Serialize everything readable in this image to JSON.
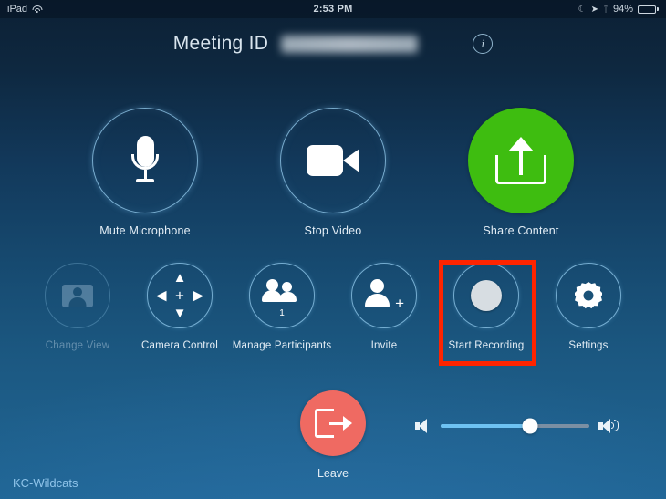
{
  "statusbar": {
    "device": "iPad",
    "wifi_icon": "wifi-icon",
    "time": "2:53 PM",
    "moon_icon": "do-not-disturb-moon-icon",
    "location_icon": "location-arrow-icon",
    "bluetooth_icon": "bluetooth-icon",
    "battery_percent": "94%",
    "battery_level": 94
  },
  "header": {
    "meeting_id_label": "Meeting ID",
    "meeting_id_value": "",
    "meeting_id_redacted": true,
    "info_icon": "info-icon"
  },
  "controls": {
    "row1": [
      {
        "id": "mute-microphone",
        "label": "Mute Microphone",
        "icon": "microphone-icon",
        "style": "outline",
        "enabled": true
      },
      {
        "id": "stop-video",
        "label": "Stop Video",
        "icon": "video-camera-icon",
        "style": "outline",
        "enabled": true
      },
      {
        "id": "share-content",
        "label": "Share Content",
        "icon": "share-upload-icon",
        "style": "green-filled",
        "enabled": true,
        "color": "#3ebd10"
      }
    ],
    "row2": [
      {
        "id": "change-view",
        "label": "Change View",
        "icon": "contact-card-icon",
        "enabled": false
      },
      {
        "id": "camera-control",
        "label": "Camera Control",
        "icon": "camera-dpad-icon",
        "enabled": true
      },
      {
        "id": "manage-participants",
        "label": "Manage Participants",
        "icon": "two-people-icon",
        "enabled": true,
        "badge": "1"
      },
      {
        "id": "invite",
        "label": "Invite",
        "icon": "add-person-icon",
        "enabled": true
      },
      {
        "id": "start-recording",
        "label": "Start Recording",
        "icon": "record-dot-icon",
        "enabled": true,
        "highlighted": true
      },
      {
        "id": "settings",
        "label": "Settings",
        "icon": "gear-icon",
        "enabled": true
      }
    ]
  },
  "highlight": {
    "color": "#ff2400",
    "target": "start-recording"
  },
  "leave": {
    "label": "Leave",
    "icon": "exit-arrow-icon",
    "color": "#ef6a62"
  },
  "volume": {
    "low_icon": "speaker-low-icon",
    "high_icon": "speaker-high-icon",
    "value_percent": 60
  },
  "footer": {
    "network_name": "KC-Wildcats"
  },
  "theme": {
    "background_top": "#0c2034",
    "background_bottom": "#1f6594",
    "ring_color": "#96cdf0",
    "text_color": "#e3edf5",
    "accent_green": "#3ebd10",
    "accent_red": "#ef6a62",
    "highlight_red": "#ff2400",
    "slider_fill": "#6ec2f2",
    "footer_color": "#8fc4ea"
  }
}
